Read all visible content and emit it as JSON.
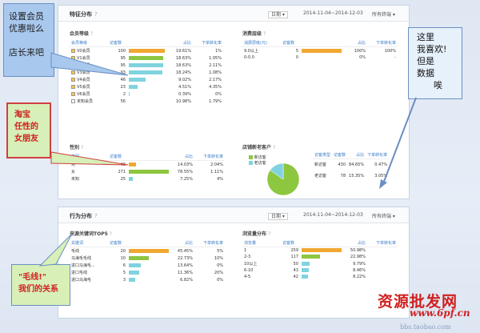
{
  "feature_panel": {
    "title": "特征分布",
    "date_label": "日期",
    "date_range": "2014-11-04~2014-12-03",
    "filter": "所有终端",
    "member_level": {
      "title": "会员等级",
      "headers": [
        "会员等级",
        "访客数",
        "",
        "占比",
        "下单转化率"
      ],
      "rows": [
        {
          "name": "V0会员",
          "visitors": "100",
          "pct": "19.61%",
          "conv": "1%",
          "bar": 0.9,
          "color": "org"
        },
        {
          "name": "V1会员",
          "visitors": "95",
          "pct": "18.63%",
          "conv": "1.05%",
          "bar": 0.86,
          "color": "grn"
        },
        {
          "name": "V2会员",
          "visitors": "95",
          "pct": "18.63%",
          "conv": "2.11%",
          "bar": 0.86,
          "color": "cyn"
        },
        {
          "name": "V3会员",
          "visitors": "93",
          "pct": "18.24%",
          "conv": "1.08%",
          "bar": 0.84,
          "color": "cyn"
        },
        {
          "name": "V4会员",
          "visitors": "46",
          "pct": "9.02%",
          "conv": "2.17%",
          "bar": 0.42,
          "color": "cyn"
        },
        {
          "name": "V5会员",
          "visitors": "23",
          "pct": "4.51%",
          "conv": "4.35%",
          "bar": 0.21,
          "color": "cyn"
        },
        {
          "name": "V6会员",
          "visitors": "2",
          "pct": "0.39%",
          "conv": "0%",
          "bar": 0.02,
          "color": "cyn"
        },
        {
          "name": "未知会员",
          "visitors": "56",
          "pct": "10.98%",
          "conv": "1.79%",
          "bar": 0,
          "color": "cyn"
        }
      ]
    },
    "consumption": {
      "title": "消费层级",
      "headers": [
        "消费层级(元)",
        "访客数",
        "",
        "占比",
        "下单转化率"
      ],
      "rows": [
        {
          "name": "9.0以上",
          "visitors": "5",
          "pct": "100%",
          "conv": "100%",
          "bar": 1,
          "color": "org"
        },
        {
          "name": "0-0.0",
          "visitors": "0",
          "pct": "0%",
          "conv": "-",
          "bar": 0,
          "color": "cyn"
        }
      ]
    },
    "gender": {
      "title": "性别",
      "headers": [
        "性别",
        "访客数",
        "",
        "占比",
        "下单转化率"
      ],
      "rows": [
        {
          "name": "男",
          "visitors": "49",
          "pct": "14.03%",
          "conv": "2.04%",
          "bar": 0.18,
          "color": "org"
        },
        {
          "name": "女",
          "visitors": "271",
          "pct": "78.55%",
          "conv": "1.11%",
          "bar": 1,
          "color": "grn"
        },
        {
          "name": "未知",
          "visitors": "25",
          "pct": "7.25%",
          "conv": "4%",
          "bar": 0.09,
          "color": "cyn"
        }
      ]
    },
    "new_old": {
      "title": "店铺新老客户",
      "legend": [
        "新访客",
        "老访客"
      ],
      "headers": [
        "访客类型",
        "访客数",
        "占比",
        "下单转化率"
      ],
      "rows": [
        {
          "name": "新访客",
          "visitors": "430",
          "pct": "84.65%",
          "conv": "0.47%"
        },
        {
          "name": "老访客",
          "visitors": "78",
          "pct": "15.35%",
          "conv": "3.05%"
        }
      ],
      "pie_new_fraction": 0.8465,
      "colors": {
        "new": "#8dc63f",
        "old": "#7fd3df"
      }
    }
  },
  "behavior_panel": {
    "title": "行为分布",
    "date_label": "日期",
    "date_range": "2014-11-04~2014-12-03",
    "filter": "所有终端",
    "keywords": {
      "title": "来源关键词TOP5",
      "headers": [
        "关键词",
        "访客数",
        "",
        "占比",
        "下单转化率"
      ],
      "rows": [
        {
          "name": "毛线",
          "visitors": "20",
          "pct": "45.45%",
          "conv": "5%",
          "bar": 1,
          "color": "org"
        },
        {
          "name": "马海毛毛线",
          "visitors": "10",
          "pct": "22.73%",
          "conv": "10%",
          "bar": 0.5,
          "color": "grn"
        },
        {
          "name": "进口马海毛...",
          "visitors": "6",
          "pct": "13.64%",
          "conv": "0%",
          "bar": 0.3,
          "color": "cyn"
        },
        {
          "name": "进口毛线",
          "visitors": "5",
          "pct": "11.36%",
          "conv": "20%",
          "bar": 0.25,
          "color": "cyn"
        },
        {
          "name": "进口马海毛",
          "visitors": "3",
          "pct": "6.82%",
          "conv": "0%",
          "bar": 0.15,
          "color": "cyn"
        }
      ]
    },
    "page_views": {
      "title": "浏览量分布",
      "headers": [
        "浏览量",
        "访客数",
        "",
        "占比",
        "下单转化率"
      ],
      "rows": [
        {
          "name": "1",
          "visitors": "259",
          "pct": "50.98%",
          "conv": "",
          "bar": 1,
          "color": "org"
        },
        {
          "name": "2-3",
          "visitors": "117",
          "pct": "22.98%",
          "conv": "",
          "bar": 0.45,
          "color": "grn"
        },
        {
          "name": "10以上",
          "visitors": "50",
          "pct": "9.79%",
          "conv": "",
          "bar": 0.19,
          "color": "cyn"
        },
        {
          "name": "6-10",
          "visitors": "43",
          "pct": "8.46%",
          "conv": "",
          "bar": 0.17,
          "color": "cyn"
        },
        {
          "name": "4-5",
          "visitors": "42",
          "pct": "8.22%",
          "conv": "",
          "bar": 0.16,
          "color": "cyn"
        }
      ]
    }
  },
  "annotations": {
    "bubble1": [
      "设置会员",
      "优惠啦么",
      "",
      "店长来吧"
    ],
    "bubble2": [
      "淘宝",
      "任性的",
      "女朋友"
    ],
    "bubble3": [
      "这里",
      "我喜欢!",
      "但是",
      "数据",
      "      唉"
    ],
    "bubble4": [
      "\"毛线!\"",
      "我们的关系"
    ]
  },
  "watermark": {
    "line1": "资源批发网",
    "line2": "www.6pf.cn",
    "line3": "bbs.taobao.com"
  }
}
